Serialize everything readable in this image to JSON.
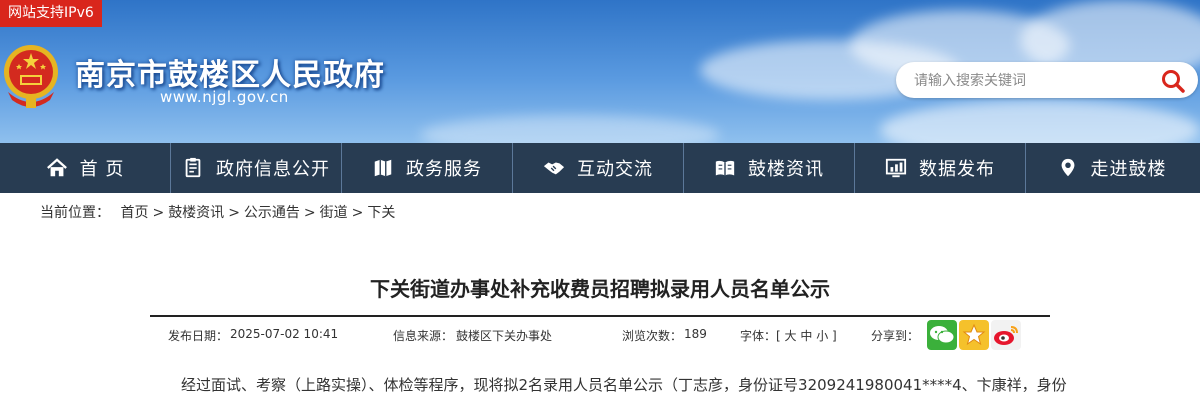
{
  "header": {
    "ipv6_badge": "网站支持IPv6",
    "site_title": "南京市鼓楼区人民政府",
    "site_url": "www.njgl.gov.cn",
    "search_placeholder": "请输入搜索关键词",
    "emblem_icon": "national-emblem-icon",
    "search_icon": "search-icon",
    "colors": {
      "sky": "#4a8ad8",
      "badge": "#d9261c",
      "search_icon": "#d9261c"
    }
  },
  "nav": {
    "items": [
      {
        "label": "首 页",
        "icon": "home-icon"
      },
      {
        "label": "政府信息公开",
        "icon": "document-icon"
      },
      {
        "label": "政务服务",
        "icon": "map-icon"
      },
      {
        "label": "互动交流",
        "icon": "handshake-icon"
      },
      {
        "label": "鼓楼资讯",
        "icon": "book-icon"
      },
      {
        "label": "数据发布",
        "icon": "chart-icon"
      },
      {
        "label": "走进鼓楼",
        "icon": "location-pin-icon"
      }
    ],
    "color": "#283c52"
  },
  "breadcrumb": {
    "prefix": "当前位置：",
    "items": [
      "首页",
      "鼓楼资讯",
      "公示通告",
      "街道",
      "下关"
    ],
    "separator": ">"
  },
  "article": {
    "title": "下关街道办事处补充收费员招聘拟录用人员名单公示",
    "meta": {
      "date_label": "发布日期：",
      "date": "2025-07-02 10:41",
      "source_label": "信息来源：",
      "source": "鼓楼区下关办事处",
      "views_label": "浏览次数：",
      "views": "189",
      "font_label": "字体：[",
      "font_large": "大",
      "font_medium": "中",
      "font_small": "小",
      "font_close": "]",
      "share_label": "分享到："
    },
    "share_icons": [
      "wechat-icon",
      "qzone-icon",
      "weibo-icon"
    ],
    "body_first_line": "经过面试、考察（上路实操）、体检等程序，现将拟2名录用人员名单公示（丁志彦，身份证号3209241980041****4、卞康祥，身份"
  }
}
